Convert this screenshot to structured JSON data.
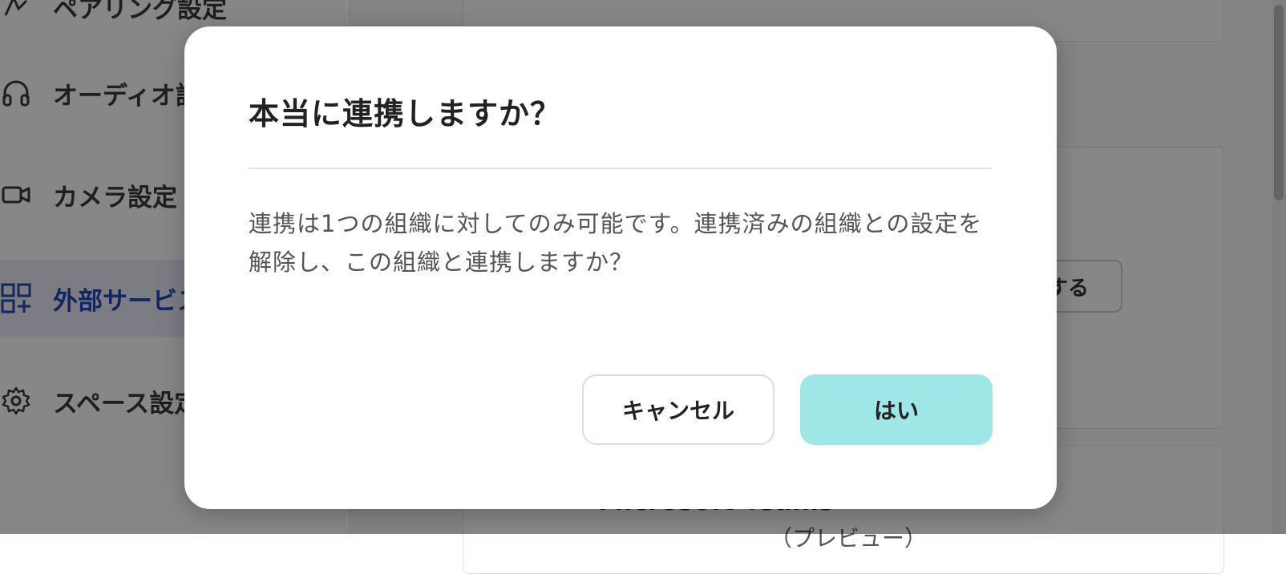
{
  "sidebar": {
    "items": [
      {
        "label": "ペアリング設定",
        "icon": "pairing-icon",
        "active": false
      },
      {
        "label": "オーディオ設定",
        "icon": "headphones-icon",
        "active": false
      },
      {
        "label": "カメラ設定",
        "icon": "video-camera-icon",
        "active": false
      },
      {
        "label": "外部サービス連携",
        "icon": "apps-add-icon",
        "active": true
      },
      {
        "label": "スペース設定",
        "icon": "gear-icon",
        "active": false
      }
    ]
  },
  "main": {
    "connect_button_label": "連携する",
    "service_name": "Microsoft Teams",
    "service_sub": "（プレビュー）"
  },
  "dialog": {
    "title": "本当に連携しますか？",
    "message": "連携は1つの組織に対してのみ可能です。連携済みの組織との設定を解除し、この組織と連携しますか？",
    "cancel_label": "キャンセル",
    "confirm_label": "はい"
  },
  "colors": {
    "overlay": "#000000",
    "confirm_button": "#9ee7e6",
    "active_sidebar_text": "#2649b8",
    "active_sidebar_bg": "#e8edf7"
  }
}
